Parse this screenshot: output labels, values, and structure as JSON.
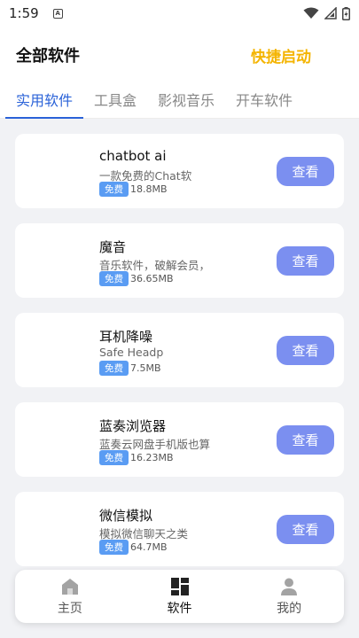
{
  "status": {
    "time": "1:59"
  },
  "header": {
    "title": "全部软件",
    "quick_launch": "快捷启动"
  },
  "tabs": [
    {
      "label": "实用软件",
      "active": true
    },
    {
      "label": "工具盒",
      "active": false
    },
    {
      "label": "影视音乐",
      "active": false
    },
    {
      "label": "开车软件",
      "active": false
    }
  ],
  "apps": [
    {
      "name": "chatbot ai",
      "desc": "一款免费的Chat软",
      "badge": "免费",
      "size": "18.8MB",
      "action": "查看"
    },
    {
      "name": "魔音",
      "desc": "音乐软件，破解会员，",
      "badge": "免费",
      "size": "36.65MB",
      "action": "查看"
    },
    {
      "name": "耳机降噪",
      "desc": "Safe Headp",
      "badge": "免费",
      "size": "7.5MB",
      "action": "查看"
    },
    {
      "name": "蓝奏浏览器",
      "desc": "蓝奏云网盘手机版也算",
      "badge": "免费",
      "size": "16.23MB",
      "action": "查看"
    },
    {
      "name": "微信模拟",
      "desc": "模拟微信聊天之类",
      "badge": "免费",
      "size": "64.7MB",
      "action": "查看"
    }
  ],
  "bottom_nav": [
    {
      "label": "主页",
      "icon": "home-icon",
      "active": false
    },
    {
      "label": "软件",
      "icon": "apps-grid-icon",
      "active": true
    },
    {
      "label": "我的",
      "icon": "person-icon",
      "active": false
    }
  ],
  "colors": {
    "accent": "#2a62d8",
    "quick_launch": "#f4b400",
    "view_button": "#7b8ff0",
    "free_badge": "#5a9cf3",
    "background": "#f1f2f5"
  }
}
